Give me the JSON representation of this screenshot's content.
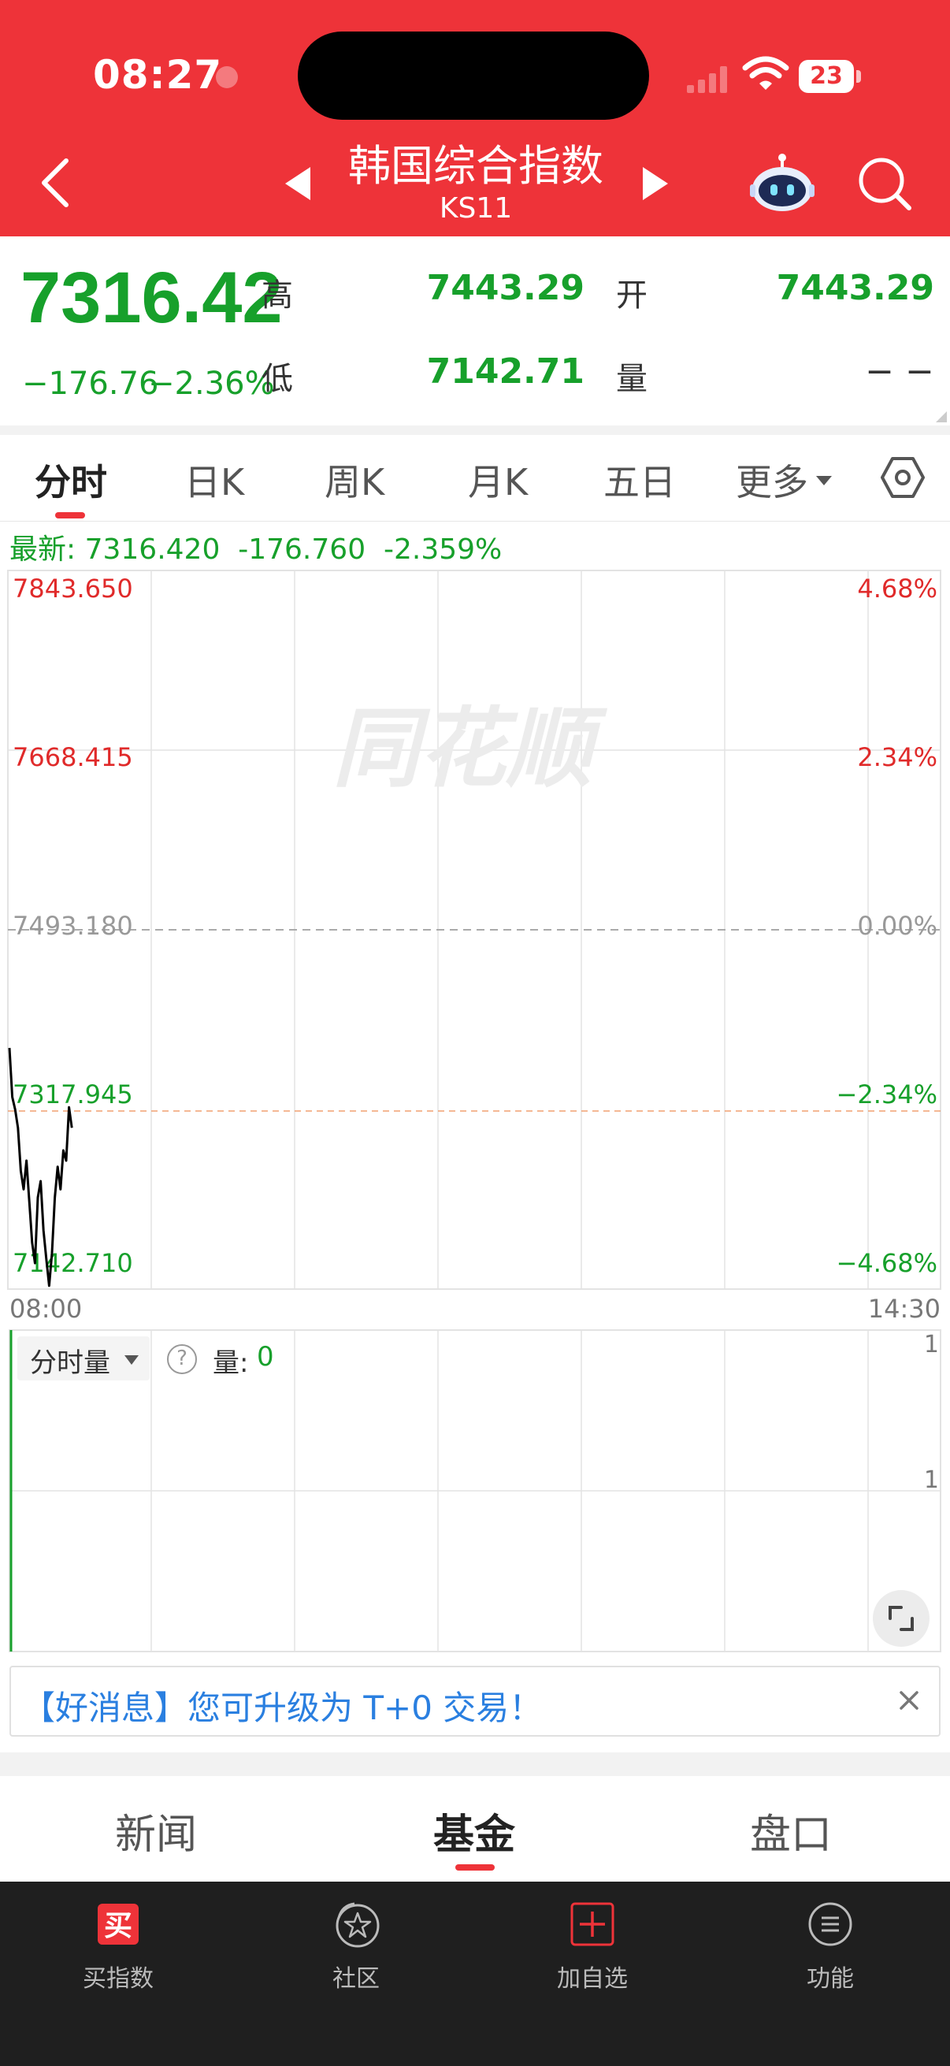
{
  "status_bar": {
    "time": "08:27",
    "battery": "23"
  },
  "header": {
    "title": "韩国综合指数",
    "code": "KS11"
  },
  "quote": {
    "price": "7316.42",
    "change": "−176.76",
    "change_pct": "−2.36%",
    "high_label": "高",
    "high": "7443.29",
    "low_label": "低",
    "low": "7142.71",
    "open_label": "开",
    "open": "7443.29",
    "volume_label": "量",
    "volume": "− −"
  },
  "tabs": [
    "分时",
    "日K",
    "周K",
    "月K",
    "五日",
    "更多"
  ],
  "latest_line": "最新: 7316.420  -176.760  -2.359%",
  "chart_data": {
    "type": "line",
    "title": "",
    "y_left_ticks": [
      "7843.650",
      "7668.415",
      "7493.180",
      "7317.945",
      "7142.710"
    ],
    "y_right_ticks": [
      "4.68%",
      "2.34%",
      "0.00%",
      "−2.34%",
      "−4.68%"
    ],
    "ylim": [
      7142.71,
      7843.65
    ],
    "prev_close": 7493.18,
    "last": 7316.42,
    "x_range": [
      "08:00",
      "14:30"
    ],
    "x_start_label": "08:00",
    "x_end_label": "14:30",
    "watermark": "同花顺",
    "colors": {
      "up": "#e02a2a",
      "down": "#17a02b",
      "line": "#000000",
      "ref": "#f0a070"
    },
    "series": [
      {
        "values": [
          7378,
          7330,
          7318,
          7300,
          7258,
          7240,
          7268,
          7228,
          7188,
          7168,
          7232,
          7248,
          7200,
          7172,
          7146,
          7178,
          7232,
          7262,
          7240,
          7278,
          7268,
          7320,
          7300
        ]
      }
    ]
  },
  "volume_panel": {
    "selector": "分时量",
    "help": "?",
    "label": "量:",
    "value": "0",
    "right_ticks": [
      "1",
      "1"
    ]
  },
  "banner": {
    "text": "【好消息】您可升级为 T+0 交易！"
  },
  "bottom_tabs": [
    "新闻",
    "基金",
    "盘口"
  ],
  "bottom_nav": [
    {
      "label": "买指数",
      "icon": "buy-icon"
    },
    {
      "label": "社区",
      "icon": "community-icon"
    },
    {
      "label": "加自选",
      "icon": "add-watchlist-icon"
    },
    {
      "label": "功能",
      "icon": "menu-icon"
    }
  ]
}
